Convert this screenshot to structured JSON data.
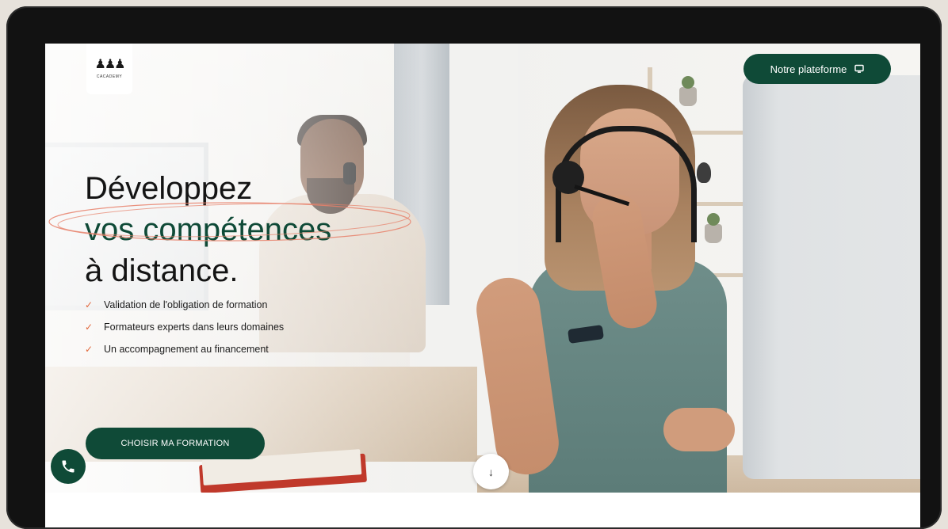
{
  "header": {
    "logo_text": "CACADEMY",
    "platform_button_label": "Notre plateforme",
    "platform_button_icon": "monitor-icon"
  },
  "hero": {
    "headline_line1": "Développez",
    "headline_line2": "vos compétences",
    "headline_line3": "à distance.",
    "benefits": [
      "Validation de l'obligation de formation",
      "Formateurs experts dans leurs domaines",
      "Un accompagnement au financement"
    ],
    "cta_label": "CHOISIR MA FORMATION",
    "scroll_icon": "↓"
  },
  "colors": {
    "brand_green": "#0f4a37",
    "accent_orange": "#e2683c",
    "bezel": "#121212"
  }
}
